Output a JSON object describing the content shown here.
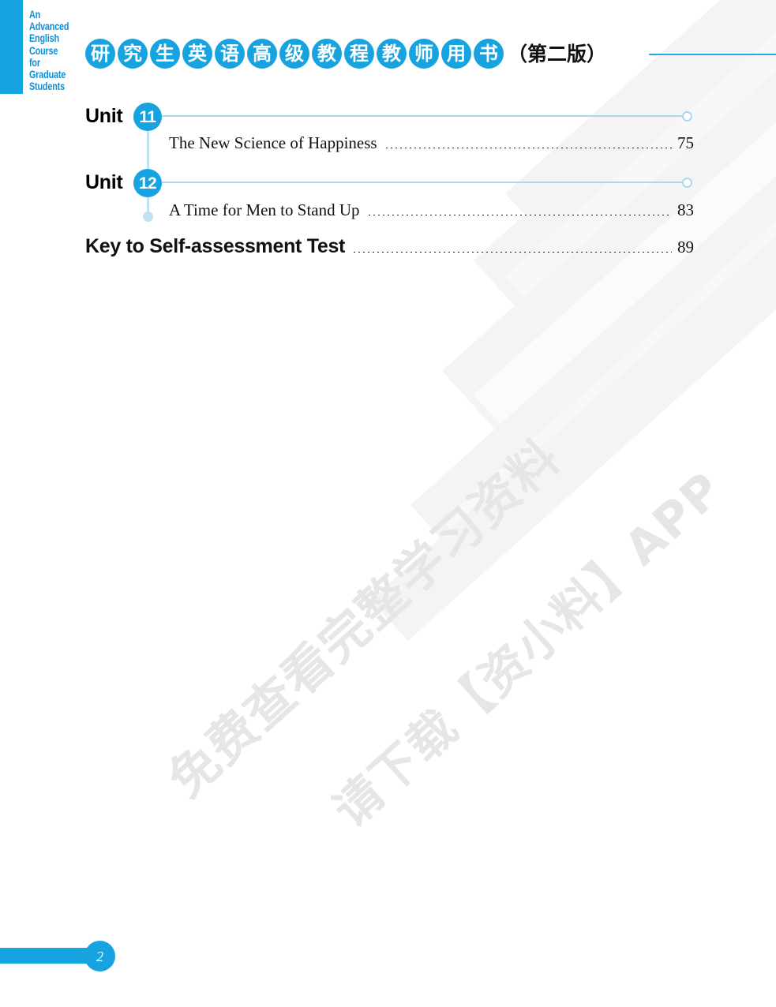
{
  "brand": {
    "lines": [
      "An",
      "Advanced",
      "English",
      "Course",
      "for",
      "Graduate",
      "Students"
    ],
    "accent_color": "#17a3e0"
  },
  "header": {
    "title_chars": [
      "研",
      "究",
      "生",
      "英",
      "语",
      "高",
      "级",
      "教",
      "程",
      "教",
      "师",
      "用",
      "书"
    ],
    "edition": "（第二版）",
    "rule_color": "#29a9e4"
  },
  "contents": {
    "units": [
      {
        "label": "Unit",
        "number": "11",
        "entry_title": "The New Science of Happiness",
        "page": "75"
      },
      {
        "label": "Unit",
        "number": "12",
        "entry_title": "A Time for Men to Stand Up",
        "page": "83"
      }
    ],
    "extra_entry": {
      "title": "Key to Self-assessment Test",
      "page": "89"
    }
  },
  "watermark": {
    "line1": "免费查看完整学习资料",
    "line2": "请下载【资小料】APP"
  },
  "footer": {
    "page_number": "2"
  }
}
